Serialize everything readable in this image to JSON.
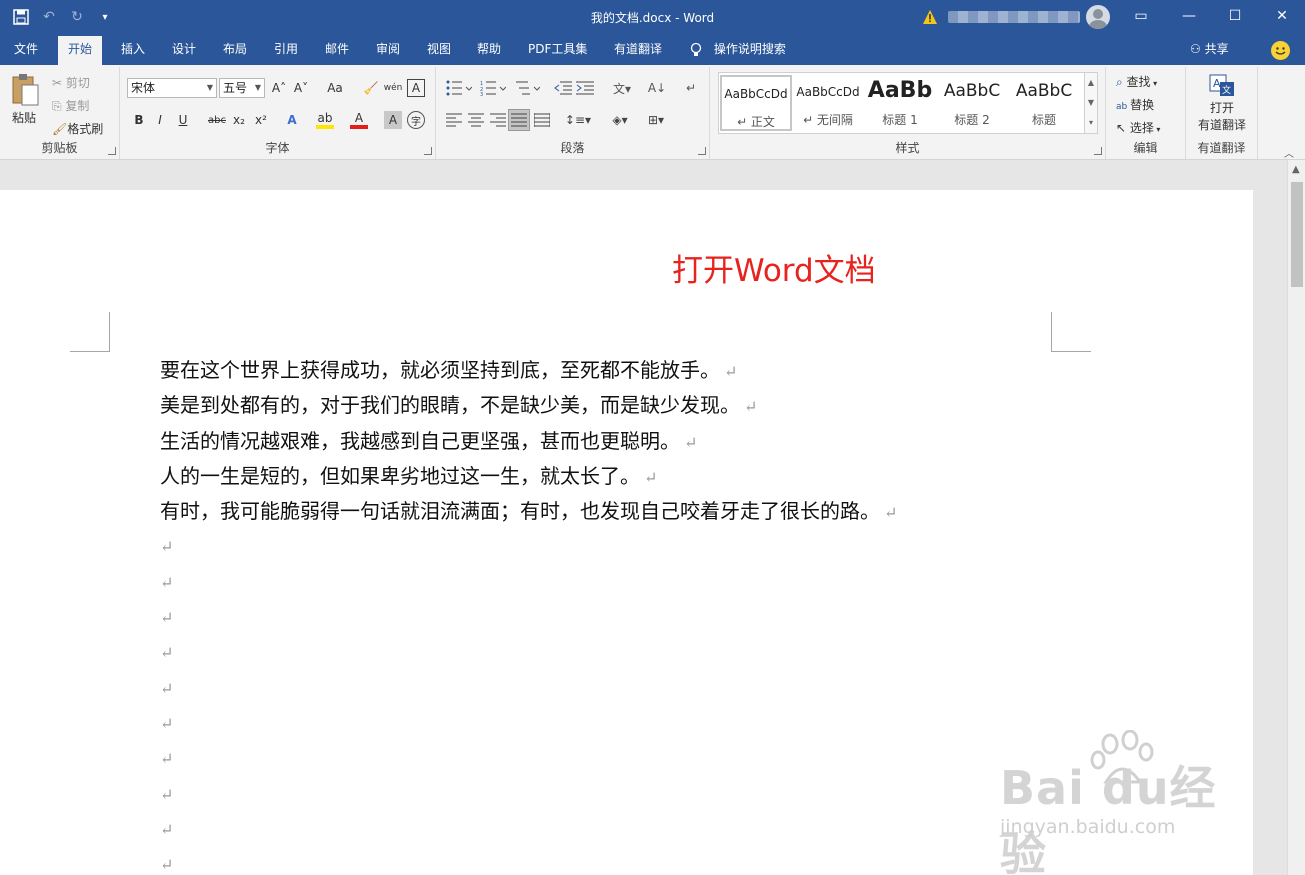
{
  "window": {
    "doc_title": "我的文档.docx  -  Word",
    "controls": {
      "restore_ribbon": "▭",
      "minimize": "—",
      "maximize": "☐",
      "close": "✕"
    }
  },
  "qat": {
    "save": "💾",
    "undo": "↶",
    "redo": "↻",
    "customize": "▾"
  },
  "tabs": [
    "文件",
    "开始",
    "插入",
    "设计",
    "布局",
    "引用",
    "邮件",
    "审阅",
    "视图",
    "帮助",
    "PDF工具集",
    "有道翻译"
  ],
  "active_tab": "开始",
  "tell_me": "操作说明搜索",
  "share": "共享",
  "ribbon": {
    "clipboard": {
      "paste": "粘贴",
      "cut": "剪切",
      "copy": "复制",
      "format_painter": "格式刷",
      "label": "剪贴板"
    },
    "font": {
      "font_name": "宋体",
      "font_size": "五号",
      "label": "字体",
      "grow": "A˄",
      "shrink": "A˅",
      "case": "Aa",
      "clear": "🧹",
      "phonetic": "wén",
      "border_char": "A",
      "bold": "B",
      "italic": "I",
      "underline": "U",
      "strike": "abc",
      "sub": "x₂",
      "sup": "x²",
      "effects": "A",
      "highlight": "ab",
      "color": "A",
      "shade": "A",
      "enclose": "字"
    },
    "paragraph": {
      "label": "段落"
    },
    "styles": {
      "label": "样式",
      "items": [
        {
          "preview": "AaBbCcDd",
          "name": "↵ 正文"
        },
        {
          "preview": "AaBbCcDd",
          "name": "↵ 无间隔"
        },
        {
          "preview": "AaBb",
          "name": "标题 1"
        },
        {
          "preview": "AaBbC",
          "name": "标题 2"
        },
        {
          "preview": "AaBbC",
          "name": "标题"
        }
      ]
    },
    "editing": {
      "label": "编辑",
      "find": "查找",
      "replace": "替换",
      "select": "选择"
    },
    "youdao": {
      "line1": "打开",
      "line2": "有道翻译",
      "label": "有道翻译"
    }
  },
  "document": {
    "annotation": "打开Word文档",
    "paragraphs": [
      "要在这个世界上获得成功，就必须坚持到底，至死都不能放手。",
      "美是到处都有的，对于我们的眼睛，不是缺少美，而是缺少发现。",
      "生活的情况越艰难，我越感到自己更坚强，甚而也更聪明。",
      "人的一生是短的，但如果卑劣地过这一生，就太长了。",
      "有时，我可能脆弱得一句话就泪流满面；有时，也发现自己咬着牙走了很长的路。"
    ],
    "paragraph_mark": "↵",
    "empty_paragraph_count": 10
  },
  "watermark": {
    "brand": "Bai du经验",
    "url": "jingyan.baidu.com"
  },
  "colors": {
    "title_bar": "#2b579a",
    "annotation": "#e8221c",
    "ribbon": "#f3f3f3"
  }
}
